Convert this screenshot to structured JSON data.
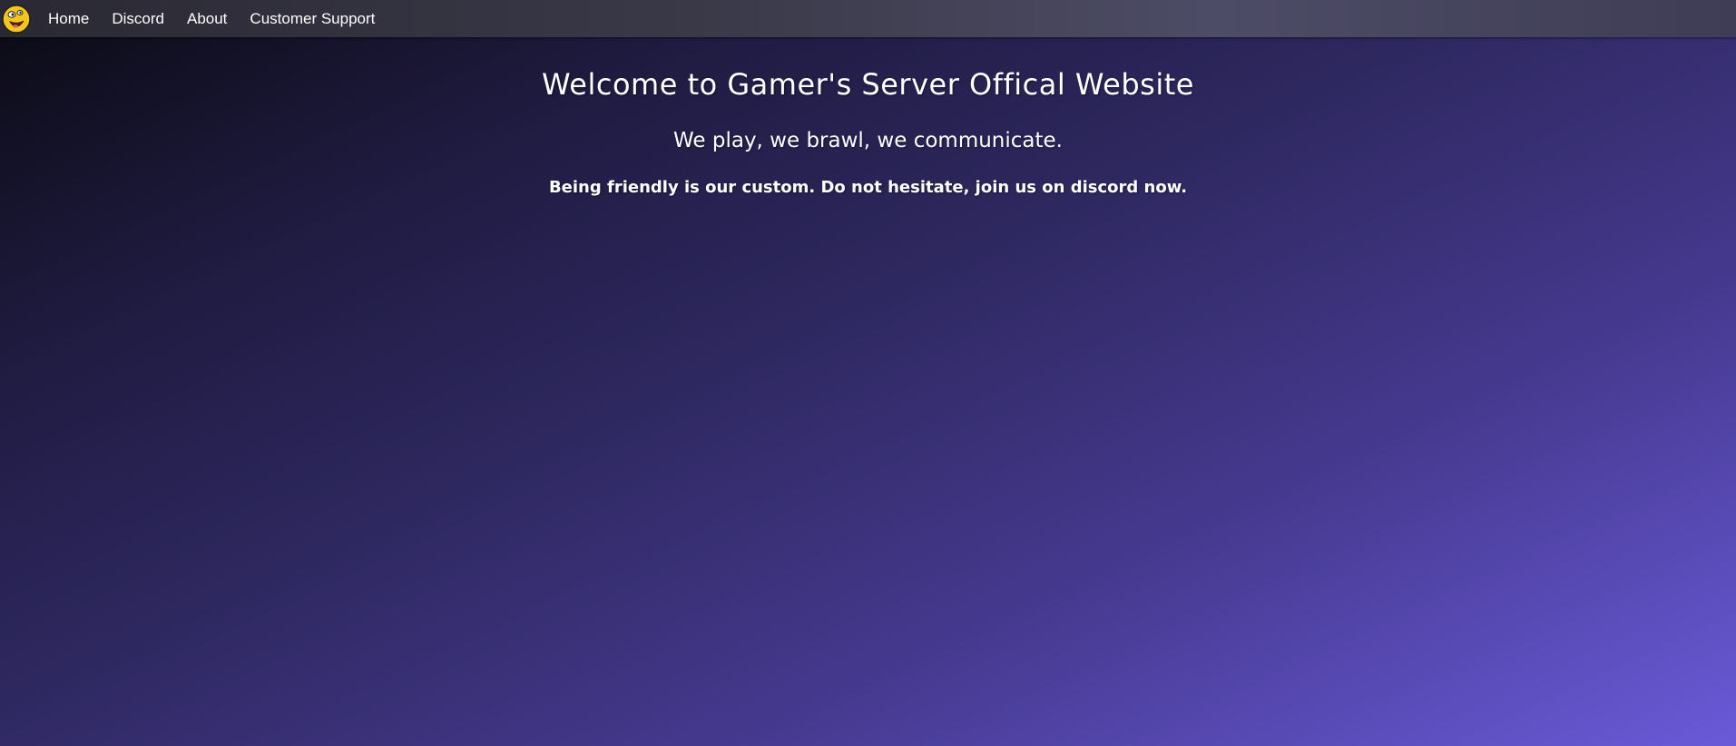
{
  "nav": {
    "logo_icon": "trollface-emoji-icon",
    "items": [
      {
        "label": "Home"
      },
      {
        "label": "Discord"
      },
      {
        "label": "About"
      },
      {
        "label": "Customer Support"
      }
    ]
  },
  "hero": {
    "title": "Welcome to Gamer's Server Offical Website",
    "subtitle": "We play, we brawl, we communicate.",
    "tagline": "Being friendly is our custom. Do not hesitate, join us on discord now."
  },
  "colors": {
    "background_start": "#0a0a12",
    "background_end": "#6a5ad8",
    "navbar": "#3a3948",
    "text": "#ffffff",
    "logo_yellow": "#f5c518"
  }
}
